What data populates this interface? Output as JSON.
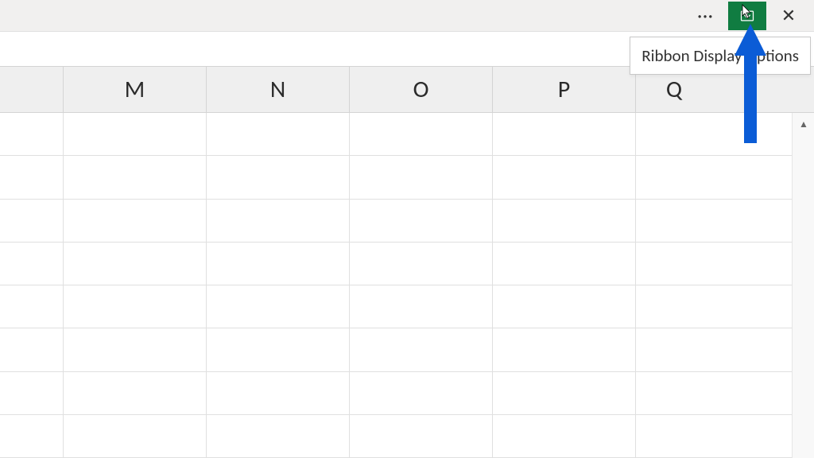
{
  "titleBar": {
    "moreLabel": "···",
    "closeLabel": "✕"
  },
  "tooltip": {
    "text": "Ribbon Display Options"
  },
  "columns": [
    "M",
    "N",
    "O",
    "P",
    "Q"
  ],
  "annotation": {
    "arrowColor": "#0b5cd6"
  }
}
